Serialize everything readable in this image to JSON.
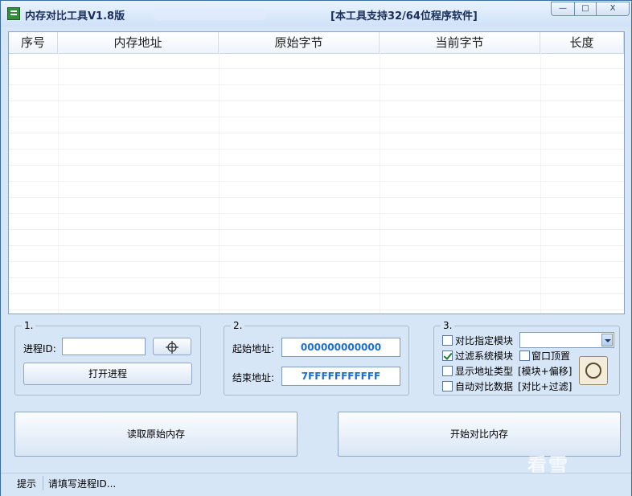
{
  "window": {
    "title": "内存对比工具V1.8版",
    "subtitle": "[本工具支持32/64位程序软件]",
    "minimize_label": "—",
    "maximize_label": "□",
    "close_label": "X"
  },
  "table": {
    "columns": [
      "序号",
      "内存地址",
      "原始字节",
      "当前字节",
      "长度"
    ],
    "rows": []
  },
  "group1": {
    "title": "1.",
    "pid_label": "进程ID:",
    "pid_value": "",
    "picker_icon": "crosshair-icon",
    "open_button": "打开进程"
  },
  "group2": {
    "title": "2.",
    "start_label": "起始地址:",
    "start_value": "000000000000",
    "end_label": "结束地址:",
    "end_value": "7FFFFFFFFFFF"
  },
  "group3": {
    "title": "3.",
    "compare_module": {
      "label": "对比指定模块",
      "checked": false
    },
    "module_select_value": "",
    "filter_system": {
      "label": "过滤系统模块",
      "checked": true
    },
    "topmost": {
      "label": "窗口顶置",
      "checked": false
    },
    "show_addr_type": {
      "label": "显示地址类型",
      "checked": false,
      "hint": "[模块+偏移]"
    },
    "auto_compare": {
      "label": "自动对比数据",
      "checked": false,
      "hint": "[对比+过滤]"
    }
  },
  "actions": {
    "read_original": "读取原始内存",
    "start_compare": "开始对比内存"
  },
  "status": {
    "label": "提示",
    "message": "请填写进程ID..."
  },
  "watermark": "看雪"
}
